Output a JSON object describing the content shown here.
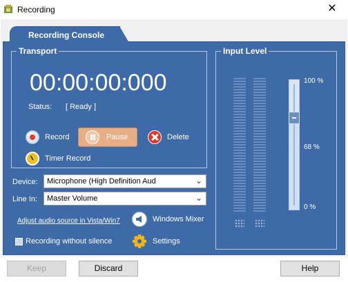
{
  "window": {
    "title": "Recording"
  },
  "tab": {
    "label": "Recording Console"
  },
  "transport": {
    "title": "Transport",
    "timer": "00:00:00:000",
    "status_label": "Status:",
    "status_value": "[ Ready ]",
    "record_label": "Record",
    "pause_label": "Pause",
    "delete_label": "Delete",
    "timer_record_label": "Timer Record"
  },
  "device": {
    "label": "Device:",
    "value": "Microphone (High Definition Aud"
  },
  "line_in": {
    "label": "Line In:",
    "value": "Master Volume"
  },
  "links": {
    "adjust_source": "Adjust audio source in Vista/Win7"
  },
  "windows_mixer": {
    "label": "Windows Mixer"
  },
  "settings": {
    "label": "Settings"
  },
  "options": {
    "record_without_silence_label": "Recording without silence",
    "record_without_silence_checked": false
  },
  "input_level": {
    "title": "Input Level",
    "tick_top": "100 %",
    "tick_mid": "68 %",
    "tick_bottom": "0 %",
    "slider_value_percent": 68
  },
  "buttons": {
    "keep": "Keep",
    "discard": "Discard",
    "help": "Help"
  },
  "colors": {
    "panel": "#3f6aa8",
    "pause_button": "#e8ae86",
    "record_dot": "#e23a2e",
    "delete": "#e0362a"
  }
}
